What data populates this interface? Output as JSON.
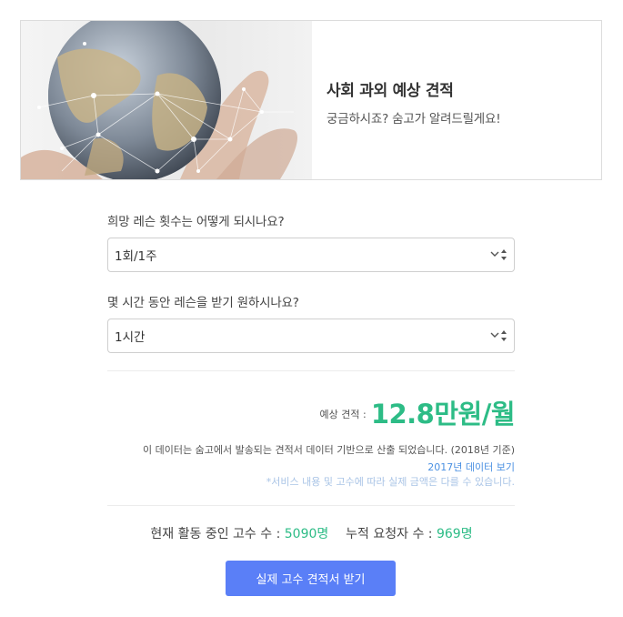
{
  "hero": {
    "title": "사회 과외 예상 견적",
    "subtitle": "궁금하시죠? 숨고가 알려드릴게요!"
  },
  "questions": [
    {
      "label": "희망 레슨 횟수는 어떻게 되시나요?",
      "selected": "1회/1주"
    },
    {
      "label": "몇 시간 동안 레슨을 받기 원하시나요?",
      "selected": "1시간"
    }
  ],
  "estimate": {
    "label": "예상 견적 :",
    "value": "12.8만원/월",
    "note": "이 데이터는 숨고에서 발송되는 견적서 데이터 기반으로 산출 되었습니다. (2018년 기준)",
    "link": "2017년 데이터 보기",
    "disclaimer": "*서비스 내용 및 고수에 따라 실제 금액은 다를 수 있습니다."
  },
  "stats": {
    "active_label": "현재 활동 중인 고수 수 :",
    "active_value": "5090명",
    "requester_label": "누적 요청자 수 :",
    "requester_value": "969명"
  },
  "cta": {
    "label": "실제 고수 견적서 받기"
  },
  "colors": {
    "accent_green": "#2dbc86",
    "button_blue": "#5a7ff7",
    "link_blue": "#4a90e2"
  },
  "icons": {
    "select": "chevron-updown-icon",
    "hero": "globe-network-image"
  }
}
